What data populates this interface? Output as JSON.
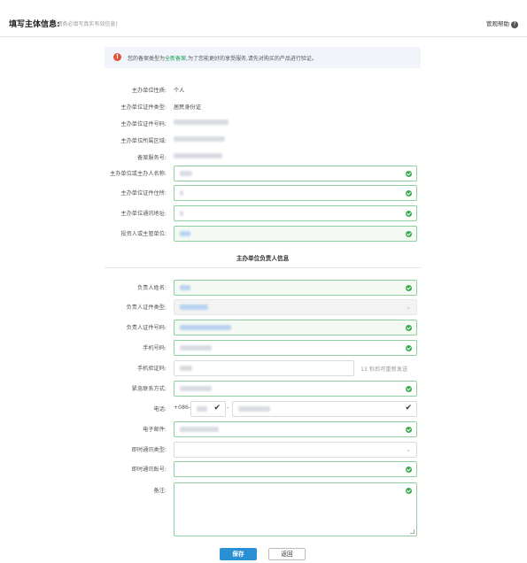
{
  "header": {
    "title": "填写主体信息:",
    "subtitle": "(请务必填写真实有效信息)",
    "help_label": "管观帮助",
    "help_icon": "question-icon"
  },
  "notice": {
    "text_before": "您的备案类型为",
    "highlight": "全新备案",
    "text_after": ",为了您能更好的享受服务,请先对购买的产品进行验证。",
    "icon": "warning-icon"
  },
  "static_rows": [
    {
      "label": "主办单位性质:",
      "value": "个人"
    },
    {
      "label": "主办单位证件类型:",
      "value": "居民身份证"
    },
    {
      "label": "主办单位证件号码:",
      "value": ""
    },
    {
      "label": "主办单位所属区域:",
      "value": ""
    },
    {
      "label": "备案服务号:",
      "value": ""
    }
  ],
  "unit_fields": [
    {
      "label": "主办单位或主办人名称:",
      "value": ""
    },
    {
      "label": "主办单位证件住所:",
      "value": ""
    },
    {
      "label": "主办单位通讯地址:",
      "value": ""
    },
    {
      "label": "投资人或主管单位:",
      "value": ""
    }
  ],
  "section_title": "主办单位负责人信息",
  "person_fields": {
    "name_label": "负责人姓名:",
    "id_type_label": "负责人证件类型:",
    "id_number_label": "负责人证件号码:",
    "mobile_label": "手机号码:",
    "sms_label": "手机验证码:",
    "sms_hint": "13 秒后可重新发送",
    "emergency_label": "紧急联系方式:",
    "phone_label": "电话:",
    "phone_prefix": "+086-",
    "phone_dash": "-",
    "email_label": "电子邮件:",
    "im_type_label": "即时通讯类型:",
    "im_account_label": "即时通讯账号:",
    "remark_label": "备注:"
  },
  "buttons": {
    "save": "保存",
    "back": "返回"
  },
  "colors": {
    "valid_border": "#8fd19e",
    "check": "#3bab52",
    "primary": "#2b8fd6",
    "warning": "#e2533a",
    "notice_bg": "#f1f5fb"
  }
}
